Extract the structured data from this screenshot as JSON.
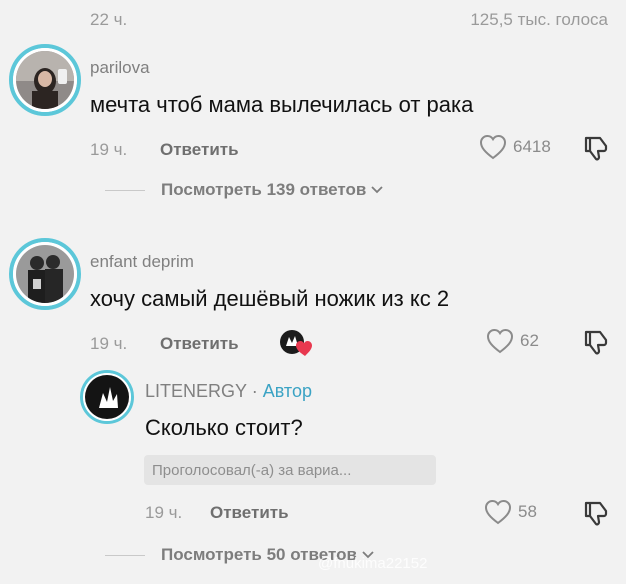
{
  "header": {
    "time": "22 ч.",
    "votes": "125,5 тыс. голоса"
  },
  "comments": [
    {
      "username": "parilova",
      "text": "мечта чтоб мама вылечилась от рака",
      "time": "19 ч.",
      "reply_label": "Ответить",
      "likes": "6418",
      "view_replies": "Посмотреть 139 ответов"
    },
    {
      "username": "enfant deprim",
      "text": "хочу самый дешёвый ножик из кс 2",
      "time": "19 ч.",
      "reply_label": "Ответить",
      "likes": "62",
      "creator_liked_icon": "creator-liked-heart-icon"
    }
  ],
  "reply": {
    "username": "LITENERGY",
    "separator": "·",
    "badge": "Автор",
    "text": "Сколько стоит?",
    "poll_chip": "Проголосовал(-а) за вариа...",
    "time": "19 ч.",
    "reply_label": "Ответить",
    "likes": "58",
    "view_replies": "Посмотреть 50 ответов"
  },
  "watermark": "@fnukima22152",
  "colors": {
    "background": "#f2f2f2",
    "avatar_ring": "#5cc7d9",
    "author_badge": "#3ba3c4",
    "creator_heart": "#e8384f"
  }
}
